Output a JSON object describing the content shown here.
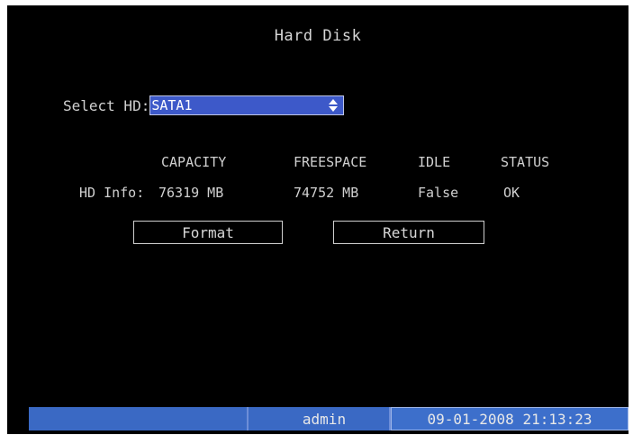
{
  "screen": {
    "title": "Hard Disk"
  },
  "select": {
    "label": "Select HD:",
    "value": "SATA1",
    "icon": "up-down-arrows-icon"
  },
  "info": {
    "headers": {
      "capacity": "CAPACITY",
      "freespace": "FREESPACE",
      "idle": "IDLE",
      "status": "STATUS"
    },
    "row_label": "HD Info:",
    "values": {
      "capacity": "76319 MB",
      "freespace": "74752 MB",
      "idle": "False",
      "status": "OK"
    }
  },
  "buttons": {
    "format": "Format",
    "return": "Return"
  },
  "status_bar": {
    "user": "admin",
    "datetime": "09-01-2008 21:13:23"
  },
  "colors": {
    "background": "#000000",
    "select_fill": "#3d59c9",
    "status_bar": "#3a69c4"
  }
}
